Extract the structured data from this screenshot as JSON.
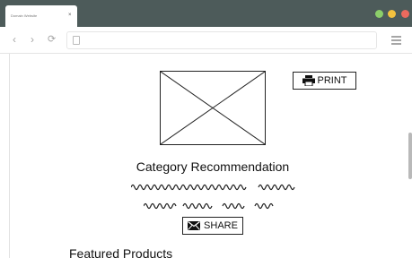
{
  "browser": {
    "tab_title": "Domain Website",
    "tab_close": "×",
    "nav": {
      "back": "‹",
      "forward": "›",
      "reload": "⟳"
    },
    "traffic_colors": [
      "#8ccf6a",
      "#f3c23e",
      "#ec6a5e"
    ]
  },
  "page": {
    "print_label": "PRINT",
    "category_title": "Category Recommendation",
    "share_label": "SHARE",
    "featured_title": "Featured Products"
  },
  "icons": {
    "image_placeholder": "image-placeholder-icon",
    "print": "printer-icon",
    "share": "envelope-icon",
    "menu": "hamburger-menu-icon"
  }
}
